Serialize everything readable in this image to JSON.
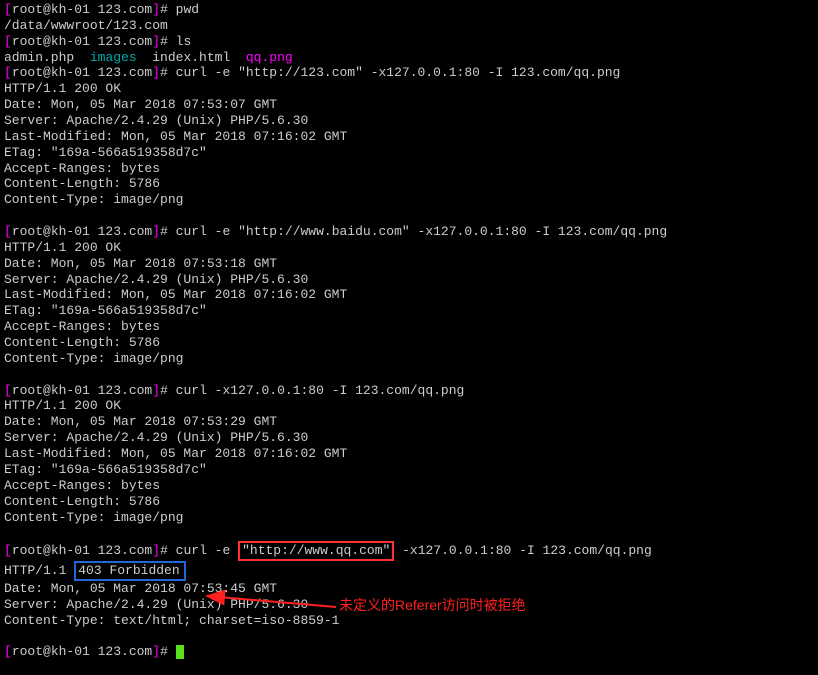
{
  "prompt": {
    "user": "root",
    "host": "kh-01",
    "cwd": "123.com",
    "symbol": "#"
  },
  "block1": {
    "cmd": "pwd",
    "out1": "/data/wwwroot/123.com"
  },
  "block2": {
    "cmd": "ls",
    "file1": "admin.php",
    "file2": "images",
    "file3": "index.html",
    "file4": "qq.png"
  },
  "block3": {
    "cmd": "curl -e \"http://123.com\" -x127.0.0.1:80 -I 123.com/qq.png",
    "l1": "HTTP/1.1 200 OK",
    "l2": "Date: Mon, 05 Mar 2018 07:53:07 GMT",
    "l3": "Server: Apache/2.4.29 (Unix) PHP/5.6.30",
    "l4": "Last-Modified: Mon, 05 Mar 2018 07:16:02 GMT",
    "l5": "ETag: \"169a-566a519358d7c\"",
    "l6": "Accept-Ranges: bytes",
    "l7": "Content-Length: 5786",
    "l8": "Content-Type: image/png"
  },
  "block4": {
    "cmd": "curl -e \"http://www.baidu.com\" -x127.0.0.1:80 -I 123.com/qq.png",
    "l1": "HTTP/1.1 200 OK",
    "l2": "Date: Mon, 05 Mar 2018 07:53:18 GMT",
    "l3": "Server: Apache/2.4.29 (Unix) PHP/5.6.30",
    "l4": "Last-Modified: Mon, 05 Mar 2018 07:16:02 GMT",
    "l5": "ETag: \"169a-566a519358d7c\"",
    "l6": "Accept-Ranges: bytes",
    "l7": "Content-Length: 5786",
    "l8": "Content-Type: image/png"
  },
  "block5": {
    "cmd": "curl -x127.0.0.1:80 -I 123.com/qq.png",
    "l1": "HTTP/1.1 200 OK",
    "l2": "Date: Mon, 05 Mar 2018 07:53:29 GMT",
    "l3": "Server: Apache/2.4.29 (Unix) PHP/5.6.30",
    "l4": "Last-Modified: Mon, 05 Mar 2018 07:16:02 GMT",
    "l5": "ETag: \"169a-566a519358d7c\"",
    "l6": "Accept-Ranges: bytes",
    "l7": "Content-Length: 5786",
    "l8": "Content-Type: image/png"
  },
  "block6": {
    "cmd_pre": "curl -e ",
    "cmd_boxed": "\"http://www.qq.com\"",
    "cmd_post": " -x127.0.0.1:80 -I 123.com/qq.png",
    "l1_pre": "HTTP/1.1",
    "l1_boxed": "403 Forbidden",
    "l2": "Date: Mon, 05 Mar 2018 07:53:45 GMT",
    "l3": "Server: Apache/2.4.29 (Unix) PHP/5.6.30",
    "l4": "Content-Type: text/html; charset=iso-8859-1"
  },
  "annotation": "未定义的Referer访问时被拒绝"
}
